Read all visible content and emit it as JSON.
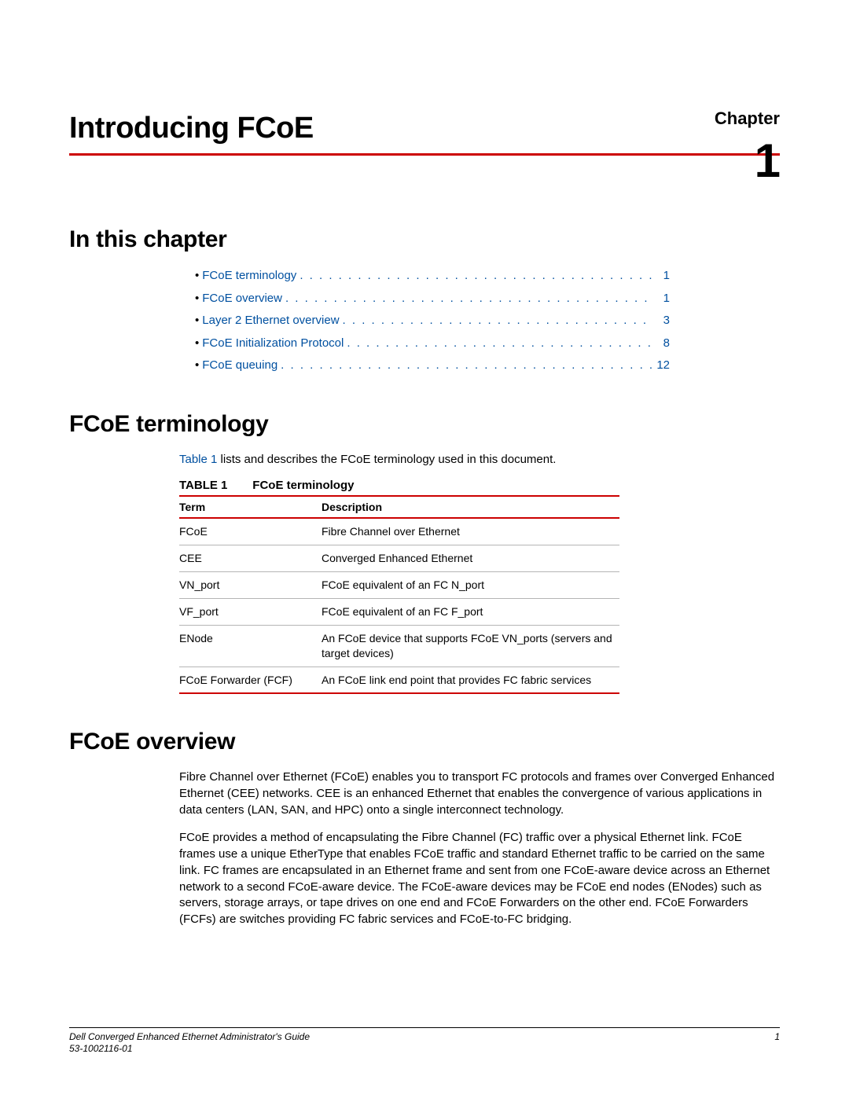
{
  "header": {
    "chapter_word": "Chapter",
    "chapter_number": "1",
    "chapter_title": "Introducing FCoE"
  },
  "sections": {
    "in_this_chapter": "In this chapter",
    "fcoe_terminology": "FCoE terminology",
    "fcoe_overview": "FCoE overview"
  },
  "toc": [
    {
      "label": "FCoE terminology",
      "page": "1"
    },
    {
      "label": "FCoE overview",
      "page": "1"
    },
    {
      "label": "Layer 2 Ethernet overview",
      "page": "3"
    },
    {
      "label": "FCoE Initialization Protocol",
      "page": "8"
    },
    {
      "label": "FCoE queuing",
      "page": "12"
    }
  ],
  "terminology": {
    "intro_link": "Table 1",
    "intro_rest": " lists and describes the FCoE terminology used in this document.",
    "table_label": "TABLE 1",
    "table_caption": "FCoE terminology",
    "col_term": "Term",
    "col_desc": "Description",
    "rows": [
      {
        "term": "FCoE",
        "desc": "Fibre Channel over Ethernet"
      },
      {
        "term": "CEE",
        "desc": "Converged Enhanced Ethernet"
      },
      {
        "term": "VN_port",
        "desc": "FCoE equivalent of an FC N_port"
      },
      {
        "term": "VF_port",
        "desc": "FCoE equivalent of an FC F_port"
      },
      {
        "term": "ENode",
        "desc": "An FCoE device that supports FCoE VN_ports (servers and target devices)"
      },
      {
        "term": "FCoE Forwarder (FCF)",
        "desc": "An FCoE link end point that provides FC fabric services"
      }
    ]
  },
  "overview": {
    "p1": "Fibre Channel over Ethernet (FCoE) enables you to transport FC protocols and frames over Converged Enhanced Ethernet (CEE) networks. CEE is an enhanced Ethernet that enables the convergence of various applications in data centers (LAN, SAN, and HPC) onto a single interconnect technology.",
    "p2": "FCoE provides a method of encapsulating the Fibre Channel (FC) traffic over a physical Ethernet link. FCoE frames use a unique EtherType that enables FCoE traffic and standard Ethernet traffic to be carried on the same link. FC frames are encapsulated in an Ethernet frame and sent from one FCoE-aware device across an Ethernet network to a second FCoE-aware device. The FCoE-aware devices may be FCoE end nodes (ENodes) such as servers, storage arrays, or tape drives on one end and FCoE Forwarders on the other end. FCoE Forwarders (FCFs) are switches providing FC fabric services and FCoE-to-FC bridging."
  },
  "footer": {
    "doc_title": "Dell Converged Enhanced Ethernet Administrator's Guide",
    "doc_id": "53-1002116-01",
    "page_num": "1"
  }
}
